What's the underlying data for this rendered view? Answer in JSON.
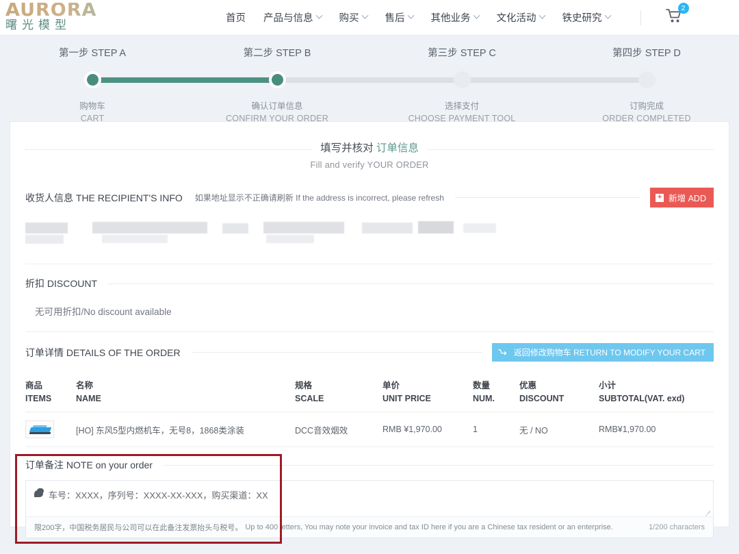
{
  "header": {
    "logo_en": "AURORA",
    "logo_cn": "曙光模型",
    "nav": [
      {
        "label": "首页",
        "has_caret": false
      },
      {
        "label": "产品与信息",
        "has_caret": true
      },
      {
        "label": "购买",
        "has_caret": true
      },
      {
        "label": "售后",
        "has_caret": true
      },
      {
        "label": "其他业务",
        "has_caret": true
      },
      {
        "label": "文化活动",
        "has_caret": true
      },
      {
        "label": "铁史研究",
        "has_caret": true
      }
    ],
    "cart_icon": "shopping-cart-icon",
    "cart_count": "2",
    "cart_badge_color": "#29b6f6"
  },
  "steps": [
    {
      "title": "第一步 STEP A",
      "label_cn": "购物车",
      "label_en": "CART",
      "active": true
    },
    {
      "title": "第二步 STEP B",
      "label_cn": "确认订单信息",
      "label_en": "CONFIRM YOUR ORDER",
      "active": true
    },
    {
      "title": "第三步 STEP C",
      "label_cn": "选择支付",
      "label_en": "CHOOSE PAYMENT TOOL",
      "active": false
    },
    {
      "title": "第四步 STEP D",
      "label_cn": "订购完成",
      "label_en": "ORDER COMPLETED",
      "active": false
    }
  ],
  "step_accent_color": "#4a8d80",
  "card": {
    "title_dark": "填写并核对",
    "title_teal": "订单信息",
    "subtitle": "Fill and verify YOUR ORDER"
  },
  "recipient": {
    "section_title": "收货人信息 THE RECIPIENT'S INFO",
    "hint": "如果地址显示不正确请刷新 If the address is incorrect, please refresh",
    "add_button": "新增 ADD",
    "add_button_color": "#ea5a55",
    "add_icon": "plus-icon"
  },
  "discount": {
    "section_title": "折扣 DISCOUNT",
    "message": "无可用折扣/No discount available"
  },
  "order_details": {
    "section_title": "订单详情 DETAILS OF THE ORDER",
    "return_button": "返回修改购物车 RETURN TO MODIFY YOUR CART",
    "return_button_color": "#6ec7ee",
    "return_icon": "cart-return-icon",
    "columns": [
      {
        "cn": "商品",
        "en": "ITEMS"
      },
      {
        "cn": "名称",
        "en": "NAME"
      },
      {
        "cn": "规格",
        "en": "SCALE"
      },
      {
        "cn": "单价",
        "en": "UNIT PRICE"
      },
      {
        "cn": "数量",
        "en": "NUM."
      },
      {
        "cn": "优惠",
        "en": "DISCOUNT"
      },
      {
        "cn": "小计",
        "en": "SUBTOTAL(VAT. exd)"
      }
    ],
    "rows": [
      {
        "thumb": "locomotive-thumbnail",
        "name": "[HO] 东风5型内燃机车，无号8，1868类涂装",
        "scale": "DCC音效烟效",
        "unit_price": "RMB ¥1,970.00",
        "num": "1",
        "discount": "无 / NO",
        "subtotal": "RMB¥1,970.00"
      }
    ]
  },
  "note": {
    "section_title": "订单备注 NOTE on your order",
    "icon": "chat-bubble-icon",
    "value": "车号：XXXX，序列号：XXXX-XX-XXX，购买渠道：XX",
    "helper_cn": "限200字，中国税务居民与公司可以在此备注发票抬头与税号。",
    "helper_en": "Up to 400 letters, You may note your invoice and tax ID here if you are a Chinese tax resident or an enterprise.",
    "counter": "1/200 characters",
    "highlight_color": "#9e1b24"
  }
}
